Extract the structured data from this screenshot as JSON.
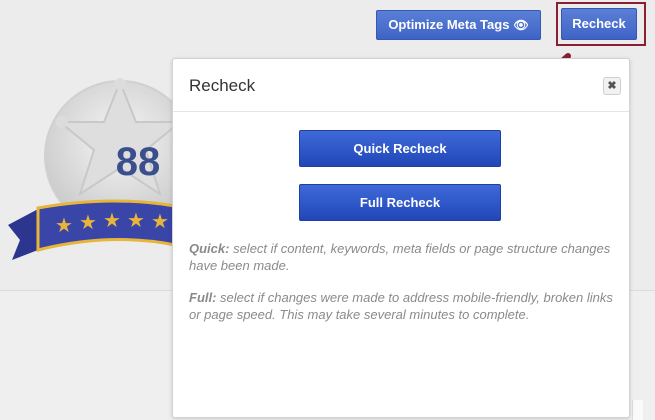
{
  "toolbar": {
    "optimize_label": "Optimize Meta Tags",
    "recheck_label": "Recheck"
  },
  "badge": {
    "score": "88",
    "stars": 5
  },
  "modal": {
    "title": "Recheck",
    "close_symbol": "✖",
    "quick_button": "Quick Recheck",
    "full_button": "Full Recheck",
    "quick_term": "Quick:",
    "quick_text": " select if content, keywords, meta fields or page structure changes have been made.",
    "full_term": "Full:",
    "full_text": " select if changes were made to address mobile-friendly, broken links or page speed. This may take several minutes to complete."
  },
  "colors": {
    "accent": "#3f64c6",
    "highlight": "#8c1e32",
    "ribbon": "#3a45a8",
    "star": "#e6b53a"
  }
}
